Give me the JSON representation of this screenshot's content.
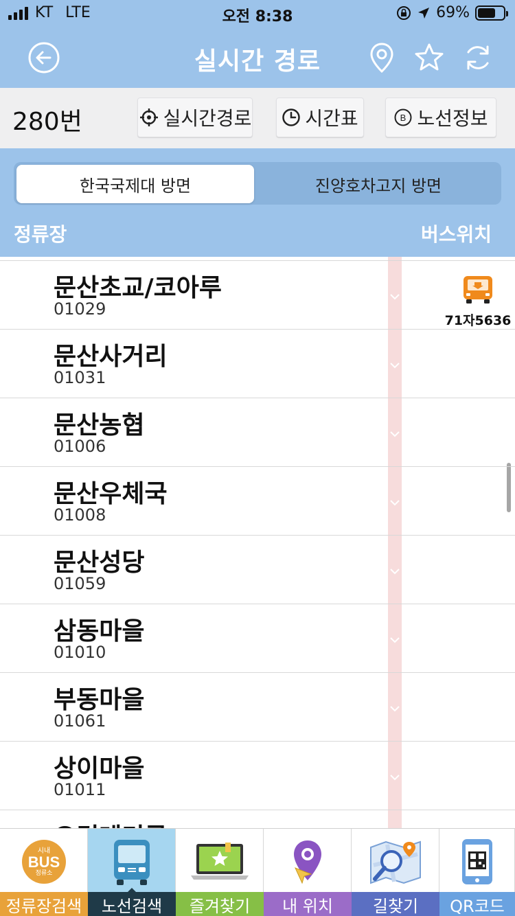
{
  "status_bar": {
    "carrier": "KT",
    "network": "LTE",
    "time": "오전 8:38",
    "battery": "69%",
    "battery_level": 0.69
  },
  "header": {
    "title": "실시간 경로",
    "icons": [
      "back-arrow-icon",
      "location-pin-icon",
      "star-icon",
      "refresh-icon"
    ]
  },
  "toolbar": {
    "route_number": "280번",
    "realtime_label": "실시간경로",
    "timetable_label": "시간표",
    "route_info_label": "노선정보"
  },
  "directions": {
    "active": "한국국제대 방면",
    "inactive": "진양호차고지 방면"
  },
  "columns": {
    "stops": "정류장",
    "bus_location": "버스위치"
  },
  "stops": [
    {
      "name": "문산초교/코아루",
      "code": "01029"
    },
    {
      "name": "문산사거리",
      "code": "01031"
    },
    {
      "name": "문산농협",
      "code": "01006"
    },
    {
      "name": "문산우체국",
      "code": "01008"
    },
    {
      "name": "문산성당",
      "code": "01059"
    },
    {
      "name": "삼동마을",
      "code": "01010"
    },
    {
      "name": "부동마을",
      "code": "01061"
    },
    {
      "name": "상이마을",
      "code": "01011"
    },
    {
      "name": "오경레미콘",
      "code": ""
    }
  ],
  "bus": {
    "plate": "71자5636",
    "stop_index": 0
  },
  "colors": {
    "header_blue": "#9cc3ea",
    "rail_pink": "#f7dcdc",
    "bus_orange": "#f08a1c"
  },
  "tabs": [
    {
      "label": "정류장검색",
      "color": "#e8a23a",
      "icon": "bus-stop-icon",
      "selected": false
    },
    {
      "label": "노선검색",
      "color": "#1f3a48",
      "icon": "bus-icon",
      "selected": true
    },
    {
      "label": "즐겨찾기",
      "color": "#86bf46",
      "icon": "favorite-laptop-icon",
      "selected": false
    },
    {
      "label": "내 위치",
      "color": "#9b6cc8",
      "icon": "my-location-icon",
      "selected": false
    },
    {
      "label": "길찾기",
      "color": "#5b6fc2",
      "icon": "map-search-icon",
      "selected": false
    },
    {
      "label": "QR코드",
      "color": "#6aa2e0",
      "icon": "qr-code-icon",
      "selected": false
    }
  ],
  "tab_bus_stop_badge": {
    "top": "시내",
    "main": "BUS",
    "bottom": "정류소"
  }
}
